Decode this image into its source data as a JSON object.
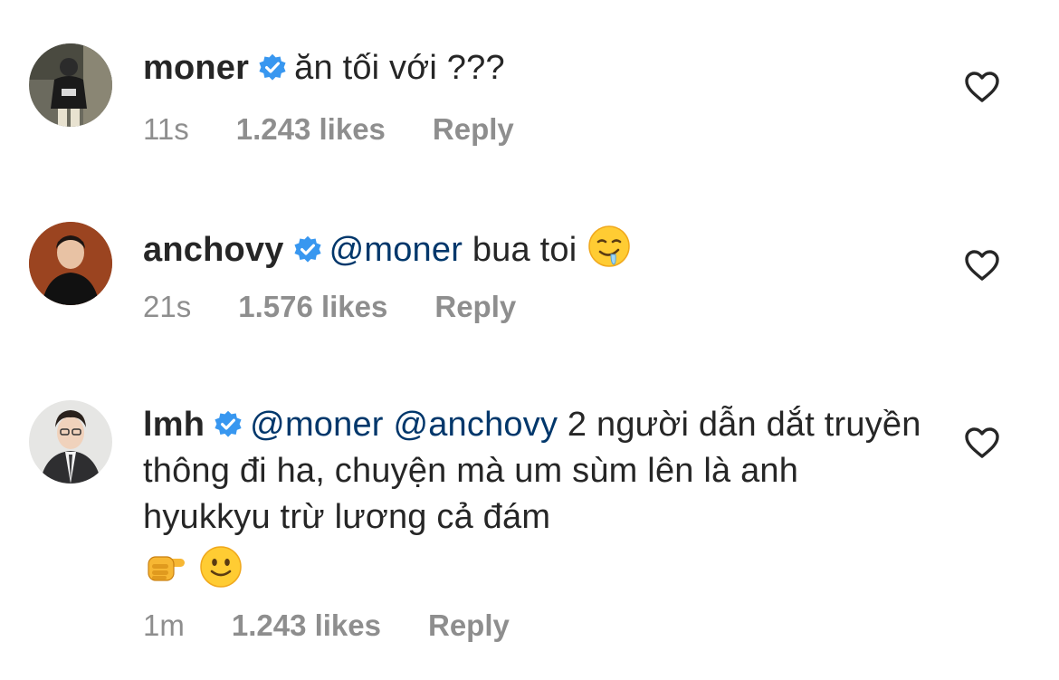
{
  "comments": [
    {
      "username": "moner",
      "verified": true,
      "text": "ăn tối với ???",
      "time": "11s",
      "likes": "1.243 likes",
      "reply_label": "Reply"
    },
    {
      "username": "anchovy",
      "verified": true,
      "mention1": "@moner",
      "text": "bua toi",
      "time": "21s",
      "likes": "1.576 likes",
      "reply_label": "Reply"
    },
    {
      "username": "lmh",
      "verified": true,
      "mention1": "@moner",
      "mention2": "@anchovy",
      "text": "2 người dẫn dắt truyền thông đi ha, chuyện mà um sùm lên là anh hyukkyu trừ lương cả đám",
      "time": "1m",
      "likes": "1.243 likes",
      "reply_label": "Reply"
    }
  ],
  "icons": {
    "verified": "verified-badge-icon",
    "like": "heart-outline-icon",
    "emoji_drooling": "drooling-face-emoji",
    "emoji_pointing": "backhand-index-pointing-right-emoji",
    "emoji_smile": "slightly-smiling-face-emoji"
  },
  "colors": {
    "text": "#262626",
    "mention": "#00376b",
    "meta": "#8e8e8e",
    "verified": "#3897f0"
  }
}
